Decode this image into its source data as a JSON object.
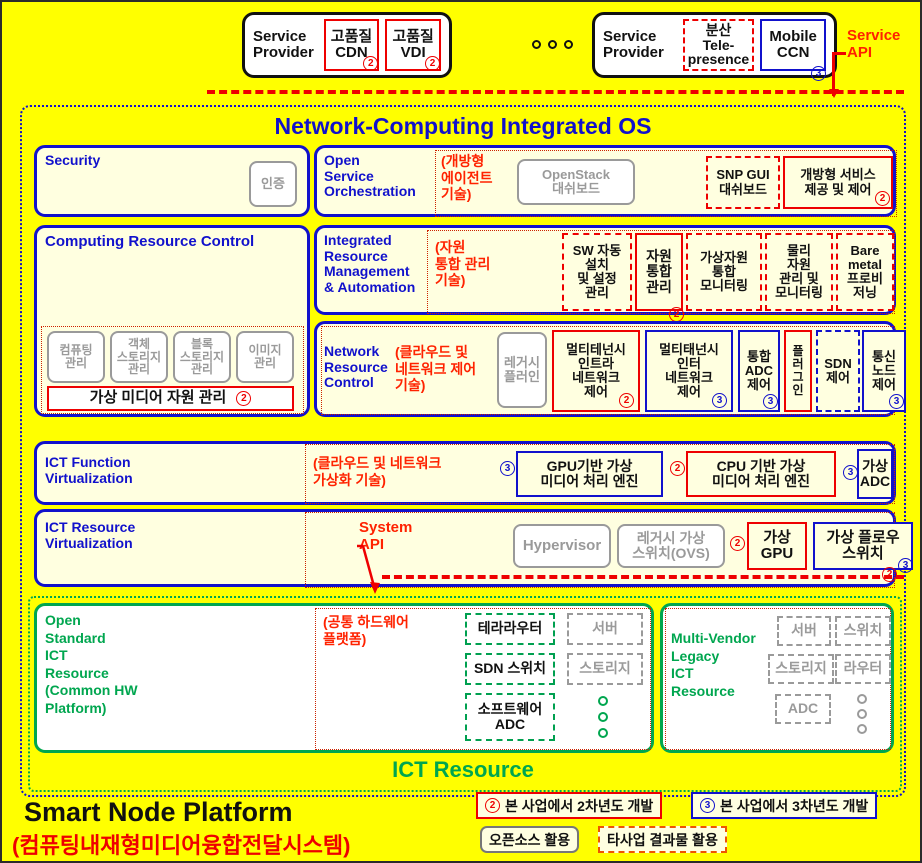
{
  "top_row": {
    "providers": [
      {
        "label": "Service\nProvider",
        "chips": [
          {
            "text": "고품질\nCDN",
            "style": "b-red",
            "badge": "2"
          },
          {
            "text": "고품질\nVDI",
            "style": "b-red",
            "badge": "2"
          }
        ]
      },
      {
        "label": "Service\nProvider",
        "chips": [
          {
            "text": "분산\nTele-\npresence",
            "style": "b-reddash",
            "badge": ""
          },
          {
            "text": "Mobile\nCCN",
            "style": "b-blue",
            "badge": "3"
          }
        ]
      }
    ],
    "ellipsis_icon": "three-dots-icon",
    "service_api_label": "Service\nAPI"
  },
  "os": {
    "title": "Network-Computing Integrated OS",
    "security": {
      "label": "Security",
      "cells": [
        {
          "text": "인증",
          "style": "gray"
        }
      ]
    },
    "open_service_orchestration": {
      "label": "Open\nService\nOrchestration",
      "paren": "(개방형\n에이전트\n기술)",
      "cells": [
        {
          "text": "OpenStack\n대쉬보드",
          "style": "gray",
          "badge": ""
        },
        {
          "text": "SNP GUI\n대쉬보드",
          "style": "reddash",
          "badge": ""
        },
        {
          "text": "개방형 서비스\n제공 및 제어",
          "style": "red",
          "badge": "2"
        }
      ]
    },
    "computing_resource_control": {
      "label": "Computing Resource Control",
      "cells": [
        {
          "text": "컴퓨팅\n관리",
          "style": "gray"
        },
        {
          "text": "객체\n스토리지\n관리",
          "style": "gray"
        },
        {
          "text": "블록\n스토리지\n관리",
          "style": "gray"
        },
        {
          "text": "이미지\n관리",
          "style": "gray"
        }
      ],
      "wide_cell": {
        "text": "가상 미디어 자원 관리",
        "style": "red",
        "badge": "2"
      }
    },
    "integrated_resource_management": {
      "label": "Integrated\nResource\nManagement\n& Automation",
      "paren": "(자원\n통합 관리\n기술)",
      "cells": [
        {
          "text": "SW 자동\n설치\n및 설정\n관리",
          "style": "reddash",
          "badge": ""
        },
        {
          "text": "자원\n통합\n관리",
          "style": "red",
          "badge": "2"
        },
        {
          "text": "가상자원\n통합\n모니터링",
          "style": "reddash",
          "badge": ""
        },
        {
          "text": "물리\n자원\n관리 및\n모니터링",
          "style": "reddash",
          "badge": ""
        },
        {
          "text": "Bare\nmetal\n프로비\n저닝",
          "style": "reddash",
          "badge": ""
        }
      ]
    },
    "network_resource_control": {
      "label": "Network\nResource\nControl",
      "paren": "(클라우드 및\n네트워크 제어\n기술)",
      "cells": [
        {
          "text": "레거시\n플러인",
          "style": "gray",
          "badge": ""
        },
        {
          "text": "멀티테넌시\n인트라\n네트워크\n제어",
          "style": "red",
          "badge": "2"
        },
        {
          "text": "멀티태넌시\n인터\n네트워크\n제어",
          "style": "blue",
          "badge": "3"
        },
        {
          "text": "통합\nADC\n제어",
          "style": "blue",
          "badge": "3"
        },
        {
          "text": "플\n러\n그\n인",
          "style": "red",
          "badge": ""
        },
        {
          "text": "SDN\n제어",
          "style": "bluedash",
          "badge": ""
        },
        {
          "text": "통신\n노드\n제어",
          "style": "blue",
          "badge": "3"
        }
      ]
    },
    "ict_function_virtualization": {
      "label": "ICT Function\nVirtualization",
      "paren": "(클라우드 및 네트워크\n가상화 기술)",
      "cells": [
        {
          "text": "GPU기반 가상\n미디어 처리 엔진",
          "style": "blue",
          "badge": "3",
          "badge_side": "left"
        },
        {
          "text": "CPU 기반 가상\n미디어 처리 엔진",
          "style": "red",
          "badge": "2",
          "badge_side": "left"
        },
        {
          "text": "가상\nADC",
          "style": "blue",
          "badge": "3",
          "badge_side": "left"
        }
      ]
    },
    "ict_resource_virtualization": {
      "label": "ICT Resource\nVirtualization",
      "system_api_label": "System\nAPI",
      "cells": [
        {
          "text": "Hypervisor",
          "style": "gray",
          "badge": ""
        },
        {
          "text": "레거시 가상\n스위치(OVS)",
          "style": "gray",
          "badge": ""
        },
        {
          "text": "가상\nGPU",
          "style": "red",
          "badge": "2",
          "badge_side": "left"
        },
        {
          "text": "가상 플로우\n스위치",
          "style": "blue",
          "badge": "3",
          "badge2": "2"
        }
      ]
    }
  },
  "ict_resource": {
    "title": "ICT Resource",
    "open_standard": {
      "label": "Open\nStandard\nICT\nResource\n(Common HW\n Platform)",
      "paren": "(공통 하드웨어\n플랫폼)",
      "col1": [
        {
          "text": "테라라우터",
          "style": "greendash"
        },
        {
          "text": "SDN 스위치",
          "style": "greendash"
        },
        {
          "text": "소프트웨어\nADC",
          "style": "greendash"
        }
      ],
      "col2": [
        {
          "text": "서버",
          "style": "graydash"
        },
        {
          "text": "스토리지",
          "style": "graydash"
        }
      ],
      "vdots_icon": "vertical-dots-icon"
    },
    "multi_vendor": {
      "label": "Multi-Vendor\nLegacy\nICT\nResource",
      "col1": [
        {
          "text": "서버",
          "style": "graydash"
        },
        {
          "text": "스토리지",
          "style": "graydash"
        },
        {
          "text": "ADC",
          "style": "graydash"
        }
      ],
      "col2": [
        {
          "text": "스위치",
          "style": "graydash"
        },
        {
          "text": "라우터",
          "style": "graydash"
        }
      ],
      "vdots_icon": "vertical-dots-icon"
    }
  },
  "footer": {
    "platform_title": "Smart Node Platform",
    "platform_subtitle": "(컴퓨팅내재형미디어융합전달시스템)",
    "legend": [
      {
        "badge": "2",
        "text": "본 사업에서 2차년도 개발",
        "style": "red"
      },
      {
        "badge": "3",
        "text": "본 사업에서 3차년도 개발",
        "style": "blue"
      },
      {
        "badge": "",
        "text": "오픈소스 활용",
        "style": "gray"
      },
      {
        "badge": "",
        "text": "타사업 결과물 활용",
        "style": "orangedash"
      }
    ]
  },
  "colors": {
    "background": "#FFFF00",
    "panel_fill": "#FFFFE0",
    "blue": "#1111CC",
    "red": "#EE0000",
    "red_text": "#FF2200",
    "green": "#00A64F",
    "gray": "#9a9a9a"
  }
}
